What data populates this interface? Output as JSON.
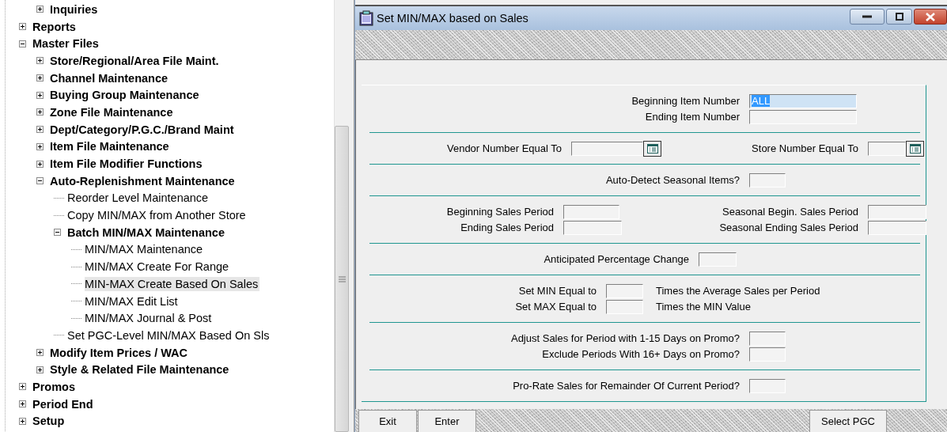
{
  "tree": [
    {
      "children": [
        {
          "label": "Inquiries",
          "kind": "folder",
          "expanded": false,
          "selected": false
        }
      ]
    },
    {
      "label": "Reports",
      "kind": "folder",
      "expanded": false,
      "selected": false
    },
    {
      "label": "Master Files",
      "kind": "folder",
      "expanded": true,
      "selected": false,
      "children": [
        {
          "label": "Store/Regional/Area File Maint.",
          "kind": "folder",
          "expanded": false,
          "selected": false
        },
        {
          "label": "Channel Maintenance",
          "kind": "folder",
          "expanded": false,
          "selected": false
        },
        {
          "label": "Buying Group Maintenance",
          "kind": "folder",
          "expanded": false,
          "selected": false
        },
        {
          "label": "Zone File Maintenance",
          "kind": "folder",
          "expanded": false,
          "selected": false
        },
        {
          "label": "Dept/Category/P.G.C./Brand Maint",
          "kind": "folder",
          "expanded": false,
          "selected": false
        },
        {
          "label": "Item File Maintenance",
          "kind": "folder",
          "expanded": false,
          "selected": false
        },
        {
          "label": "Item File Modifier Functions",
          "kind": "folder",
          "expanded": false,
          "selected": false
        },
        {
          "label": "Auto-Replenishment Maintenance",
          "kind": "folder",
          "expanded": true,
          "selected": false,
          "children": [
            {
              "label": "Reorder Level Maintenance",
              "kind": "leaf",
              "selected": false
            },
            {
              "label": "Copy MIN/MAX from Another Store",
              "kind": "leaf",
              "selected": false
            },
            {
              "label": "Batch MIN/MAX Maintenance",
              "kind": "folder",
              "expanded": true,
              "selected": false,
              "children": [
                {
                  "label": "MIN/MAX Maintenance",
                  "kind": "leaf",
                  "selected": false
                },
                {
                  "label": "MIN/MAX Create For Range",
                  "kind": "leaf",
                  "selected": false
                },
                {
                  "label": "MIN-MAX Create Based On Sales",
                  "kind": "leaf",
                  "selected": true
                },
                {
                  "label": "MIN/MAX Edit List",
                  "kind": "leaf",
                  "selected": false
                },
                {
                  "label": "MIN/MAX Journal & Post",
                  "kind": "leaf",
                  "selected": false
                }
              ]
            },
            {
              "label": "Set PGC-Level MIN/MAX Based On Sls",
              "kind": "leaf",
              "selected": false
            }
          ]
        },
        {
          "label": "Modify Item Prices / WAC",
          "kind": "folder",
          "expanded": false,
          "selected": false
        },
        {
          "label": "Style & Related File Maintenance",
          "kind": "folder",
          "expanded": false,
          "selected": false
        }
      ]
    },
    {
      "label": "Promos",
      "kind": "folder",
      "expanded": false,
      "selected": false
    },
    {
      "label": "Period End",
      "kind": "folder",
      "expanded": false,
      "selected": false
    },
    {
      "label": "Setup",
      "kind": "folder",
      "expanded": false,
      "selected": false
    }
  ],
  "window": {
    "title": "Set MIN/MAX based on Sales",
    "sections": [
      {
        "rows": [
          {
            "fields": [
              {
                "label": "Beginning Item Number",
                "value": "ALL",
                "selected": true
              }
            ]
          },
          {
            "fields": [
              {
                "label": "Ending Item Number"
              }
            ]
          }
        ]
      },
      {
        "rows": [
          {
            "fields": [
              {
                "label": "Vendor Number Equal To",
                "lookup": true
              },
              {
                "label": "Store Number Equal To",
                "lookup": true
              }
            ]
          }
        ]
      },
      {
        "rows": [
          {
            "fields": [
              {
                "label": "Auto-Detect Seasonal Items?"
              }
            ]
          }
        ]
      },
      {
        "rows": [
          {
            "fields": [
              {
                "label": "Beginning Sales Period"
              },
              {
                "label": "Seasonal Begin. Sales Period"
              }
            ]
          },
          {
            "fields": [
              {
                "label": "Ending Sales Period"
              },
              {
                "label": "Seasonal Ending Sales Period"
              }
            ]
          }
        ]
      },
      {
        "rows": [
          {
            "fields": [
              {
                "label": "Anticipated Percentage Change"
              }
            ]
          }
        ]
      },
      {
        "rows": [
          {
            "fields": [
              {
                "label": "Set MIN Equal to",
                "note": "Times the Average Sales per Period"
              }
            ]
          },
          {
            "fields": [
              {
                "label": "Set MAX Equal to",
                "note": "Times the MIN Value"
              }
            ]
          }
        ]
      },
      {
        "rows": [
          {
            "fields": [
              {
                "label": "Adjust Sales for Period with 1-15 Days on Promo?"
              }
            ]
          },
          {
            "fields": [
              {
                "label": "Exclude Periods With 16+ Days on Promo?"
              }
            ]
          }
        ]
      },
      {
        "rows": [
          {
            "fields": [
              {
                "label": "Pro-Rate Sales for Remainder Of Current Period?"
              }
            ]
          }
        ]
      }
    ],
    "buttons": [
      "Exit",
      "Enter",
      "Select PGC"
    ]
  }
}
